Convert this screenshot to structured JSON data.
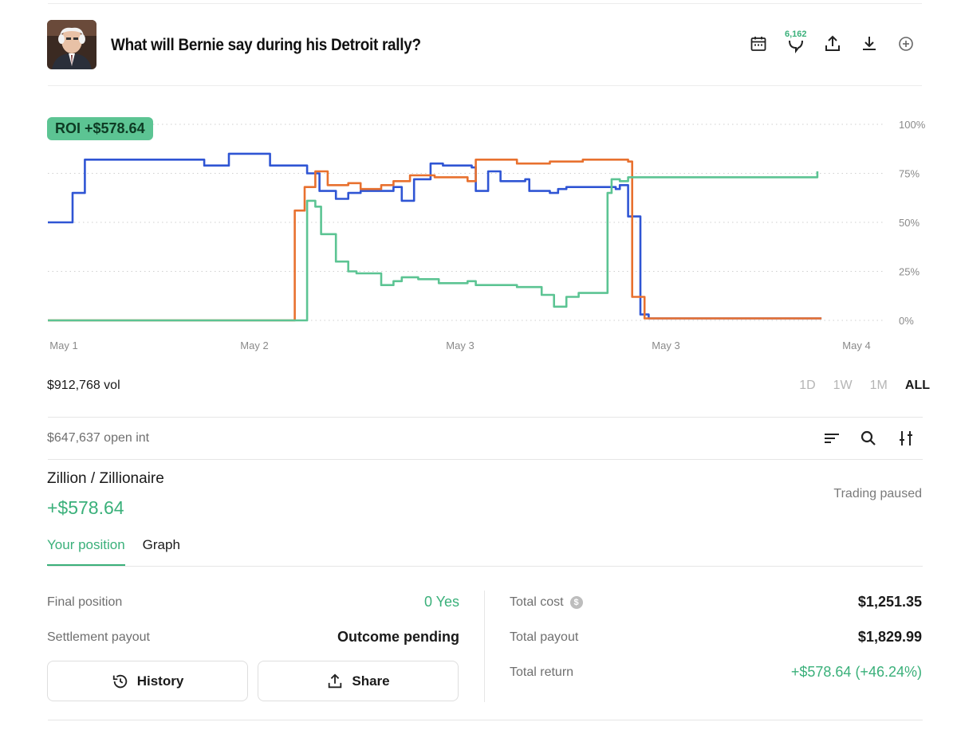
{
  "header": {
    "title": "What will Bernie say during his Detroit rally?",
    "comment_count": "6,162"
  },
  "chart": {
    "roi_badge": "ROI +$578.64",
    "volume": "$912,768 vol",
    "ranges": [
      "1D",
      "1W",
      "1M",
      "ALL"
    ],
    "active_range": "ALL"
  },
  "chart_data": {
    "type": "line",
    "x_tick_labels": [
      "May 1",
      "May 2",
      "May 3",
      "May 3",
      "May 4"
    ],
    "y_tick_labels": [
      "100%",
      "75%",
      "50%",
      "25%",
      "0%"
    ],
    "ylim": [
      0,
      100
    ],
    "xlim": [
      0,
      100
    ],
    "grid": true,
    "series": [
      {
        "color": "#2f55d4",
        "points": [
          [
            0,
            50
          ],
          [
            3,
            50
          ],
          [
            3,
            65
          ],
          [
            4.5,
            65
          ],
          [
            4.5,
            82
          ],
          [
            19,
            82
          ],
          [
            19,
            79
          ],
          [
            22,
            79
          ],
          [
            22,
            85
          ],
          [
            27,
            85
          ],
          [
            27,
            79
          ],
          [
            31.5,
            79
          ],
          [
            31.5,
            75
          ],
          [
            33,
            75
          ],
          [
            33,
            66
          ],
          [
            35,
            66
          ],
          [
            35,
            62
          ],
          [
            36.5,
            62
          ],
          [
            36.5,
            65
          ],
          [
            38,
            65
          ],
          [
            38,
            66
          ],
          [
            42,
            66
          ],
          [
            42,
            68
          ],
          [
            43,
            68
          ],
          [
            43,
            61
          ],
          [
            44.5,
            61
          ],
          [
            44.5,
            72
          ],
          [
            46.5,
            72
          ],
          [
            46.5,
            80
          ],
          [
            48,
            80
          ],
          [
            48,
            79
          ],
          [
            51.5,
            79
          ],
          [
            51.5,
            78
          ],
          [
            52,
            78
          ],
          [
            52,
            66
          ],
          [
            53.5,
            66
          ],
          [
            53.5,
            76
          ],
          [
            55,
            76
          ],
          [
            55,
            71
          ],
          [
            58,
            71
          ],
          [
            58,
            72
          ],
          [
            58.5,
            72
          ],
          [
            58.5,
            66
          ],
          [
            61,
            66
          ],
          [
            61,
            65
          ],
          [
            62,
            65
          ],
          [
            62,
            67
          ],
          [
            63,
            67
          ],
          [
            63,
            68
          ],
          [
            67,
            68
          ],
          [
            67,
            68
          ],
          [
            69,
            68
          ],
          [
            69,
            67
          ],
          [
            69.5,
            67
          ],
          [
            69.5,
            69
          ],
          [
            70.5,
            69
          ],
          [
            70.5,
            53
          ],
          [
            72,
            53
          ],
          [
            72,
            3
          ],
          [
            73,
            3
          ],
          [
            73,
            1
          ],
          [
            94,
            1
          ]
        ]
      },
      {
        "color": "#e8712f",
        "points": [
          [
            0,
            0
          ],
          [
            30,
            0
          ],
          [
            30,
            56
          ],
          [
            31.2,
            56
          ],
          [
            31.2,
            68
          ],
          [
            32.5,
            68
          ],
          [
            32.5,
            76
          ],
          [
            34,
            76
          ],
          [
            34,
            69
          ],
          [
            36.5,
            69
          ],
          [
            36.5,
            70
          ],
          [
            38,
            70
          ],
          [
            38,
            67
          ],
          [
            40.5,
            67
          ],
          [
            40.5,
            69
          ],
          [
            42,
            69
          ],
          [
            42,
            71
          ],
          [
            44,
            71
          ],
          [
            44,
            74
          ],
          [
            47,
            74
          ],
          [
            47,
            73
          ],
          [
            51,
            73
          ],
          [
            51,
            71
          ],
          [
            52,
            71
          ],
          [
            52,
            82
          ],
          [
            57,
            82
          ],
          [
            57,
            80
          ],
          [
            61,
            80
          ],
          [
            61,
            81
          ],
          [
            65,
            81
          ],
          [
            65,
            82
          ],
          [
            70.5,
            82
          ],
          [
            70.5,
            81
          ],
          [
            71,
            81
          ],
          [
            71,
            12
          ],
          [
            72.5,
            12
          ],
          [
            72.5,
            1
          ],
          [
            94,
            1
          ]
        ]
      },
      {
        "color": "#5cc493",
        "points": [
          [
            0,
            0
          ],
          [
            31.5,
            0
          ],
          [
            31.5,
            61
          ],
          [
            32.5,
            61
          ],
          [
            32.5,
            58
          ],
          [
            33.2,
            58
          ],
          [
            33.2,
            44
          ],
          [
            35,
            44
          ],
          [
            35,
            30
          ],
          [
            36.5,
            30
          ],
          [
            36.5,
            25
          ],
          [
            37.5,
            25
          ],
          [
            37.5,
            24
          ],
          [
            40.5,
            24
          ],
          [
            40.5,
            18
          ],
          [
            42,
            18
          ],
          [
            42,
            20
          ],
          [
            43,
            20
          ],
          [
            43,
            22
          ],
          [
            45,
            22
          ],
          [
            45,
            21
          ],
          [
            47.5,
            21
          ],
          [
            47.5,
            19
          ],
          [
            51,
            19
          ],
          [
            51,
            20
          ],
          [
            52,
            20
          ],
          [
            52,
            18
          ],
          [
            57,
            18
          ],
          [
            57,
            17
          ],
          [
            60,
            17
          ],
          [
            60,
            13
          ],
          [
            61.5,
            13
          ],
          [
            61.5,
            7
          ],
          [
            63,
            7
          ],
          [
            63,
            12
          ],
          [
            64.5,
            12
          ],
          [
            64.5,
            14
          ],
          [
            68,
            14
          ],
          [
            68,
            65
          ],
          [
            68.5,
            65
          ],
          [
            68.5,
            72
          ],
          [
            69.5,
            72
          ],
          [
            69.5,
            71
          ],
          [
            70.5,
            71
          ],
          [
            70.5,
            73
          ],
          [
            93.5,
            73
          ],
          [
            93.5,
            76
          ]
        ]
      }
    ]
  },
  "open_interest": "$647,637 open int",
  "market": {
    "name": "Zillion / Zillionaire",
    "gain": "+$578.64",
    "status": "Trading paused",
    "tabs": [
      "Your position",
      "Graph"
    ],
    "active_tab": "Your position"
  },
  "position": {
    "final_position_label": "Final position",
    "final_position_value": "0 Yes",
    "settlement_label": "Settlement payout",
    "settlement_value": "Outcome pending",
    "total_cost_label": "Total cost",
    "total_cost_value": "$1,251.35",
    "total_payout_label": "Total payout",
    "total_payout_value": "$1,829.99",
    "total_return_label": "Total return",
    "total_return_value": "+$578.64 (+46.24%)",
    "history_button": "History",
    "share_button": "Share"
  },
  "colors": {
    "accent_green": "#3ab07a",
    "badge_green": "#5cc493",
    "series_blue": "#2f55d4",
    "series_orange": "#e8712f"
  }
}
